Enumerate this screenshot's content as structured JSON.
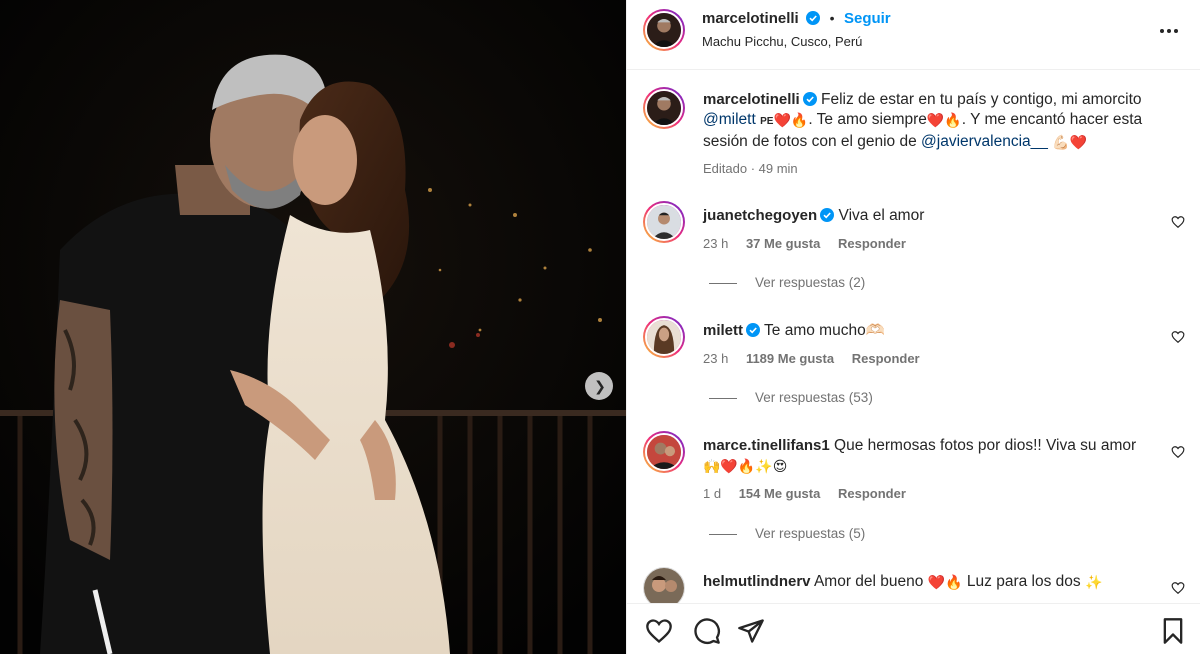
{
  "post": {
    "username": "marcelotinelli",
    "follow_label": "Seguir",
    "separator": "•",
    "location": "Machu Picchu, Cusco, Perú",
    "more_label": "•••"
  },
  "caption": {
    "username": "marcelotinelli",
    "text_1": "Feliz de estar en tu país y contigo, mi amorcito",
    "mention_1": "@milett",
    "flag": "PE",
    "emojis_1": "❤️🔥",
    "text_2": ". Te amo siempre",
    "emojis_2": "❤️🔥",
    "text_3": ". Y me encantó hacer esta sesión de fotos con el genio de",
    "mention_2": "@javiervalencia__",
    "emojis_3": "💪🏻❤️",
    "edited": "Editado · 49 min"
  },
  "comments": [
    {
      "username": "juanetchegoyen",
      "text": "Viva el amor",
      "time": "23 h",
      "likes": "37 Me gusta",
      "reply": "Responder",
      "view_replies": "Ver respuestas (2)"
    },
    {
      "username": "milett",
      "text": "Te amo mucho🫶🏻",
      "time": "23 h",
      "likes": "1189 Me gusta",
      "reply": "Responder",
      "view_replies": "Ver respuestas (53)"
    },
    {
      "username": "marce.tinellifans1",
      "text": "Que hermosas fotos por dios!! Viva su amor",
      "text_line2": "🙌❤️🔥✨😍",
      "time": "1 d",
      "likes": "154 Me gusta",
      "reply": "Responder",
      "view_replies": "Ver respuestas (5)"
    },
    {
      "username": "helmutlindnerv",
      "text": "Amor del bueno",
      "emojis": "❤️🔥",
      "text_2": "Luz para los dos",
      "emojis_2": "✨"
    }
  ],
  "icons": {
    "like": "heart-icon",
    "comment": "comment-icon",
    "share": "send-icon",
    "save": "bookmark-icon",
    "next": "chevron-right-icon"
  },
  "colors": {
    "accent": "#0095f6",
    "mention": "#00376b",
    "verified": "#0095f6",
    "muted": "#737373"
  }
}
